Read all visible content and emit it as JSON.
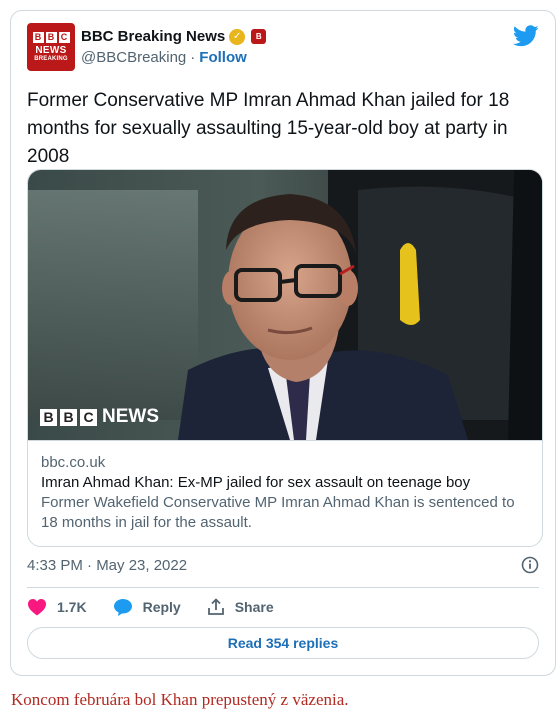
{
  "account": {
    "display_name": "BBC Breaking News",
    "handle": "@BBCBreaking",
    "separator": "·",
    "follow_label": "Follow",
    "avatar": {
      "blocks": [
        "B",
        "B",
        "C"
      ],
      "line1": "NEWS",
      "line2": "BREAKING"
    },
    "verified_icon": "verified-badge-icon",
    "org_badge": {
      "icon": "bbc-org-badge-icon",
      "text": "B"
    }
  },
  "tweet": {
    "text": "Former Conservative MP Imran Ahmad Khan jailed for 18 months for sexually assaulting 15-year-old boy at party in 2008",
    "timestamp": "4:33 PM · May 23, 2022"
  },
  "card": {
    "image_watermark": "BBC NEWS",
    "watermark_blocks": [
      "B",
      "B",
      "C"
    ],
    "watermark_word": "NEWS",
    "domain": "bbc.co.uk",
    "title": "Imran Ahmad Khan: Ex-MP jailed for sex assault on teenage boy",
    "description": "Former Wakefield Conservative MP Imran Ahmad Khan is sentenced to 18 months in jail for the assault."
  },
  "actions": {
    "likes": {
      "icon": "heart-icon",
      "label": "1.7K"
    },
    "reply": {
      "icon": "reply-bubble-icon",
      "label": "Reply"
    },
    "share": {
      "icon": "share-icon",
      "label": "Share"
    }
  },
  "read_replies_label": "Read 354 replies",
  "caption": "Koncom februára bol Khan prepustený z väzenia.",
  "colors": {
    "bbc_red": "#bb1919",
    "link_blue": "#1d6fb8",
    "twitter_blue": "#1d9bf0",
    "heart_pink": "#f91880",
    "caption_red": "#b12a23",
    "verified_gold": "#e8b51a"
  }
}
